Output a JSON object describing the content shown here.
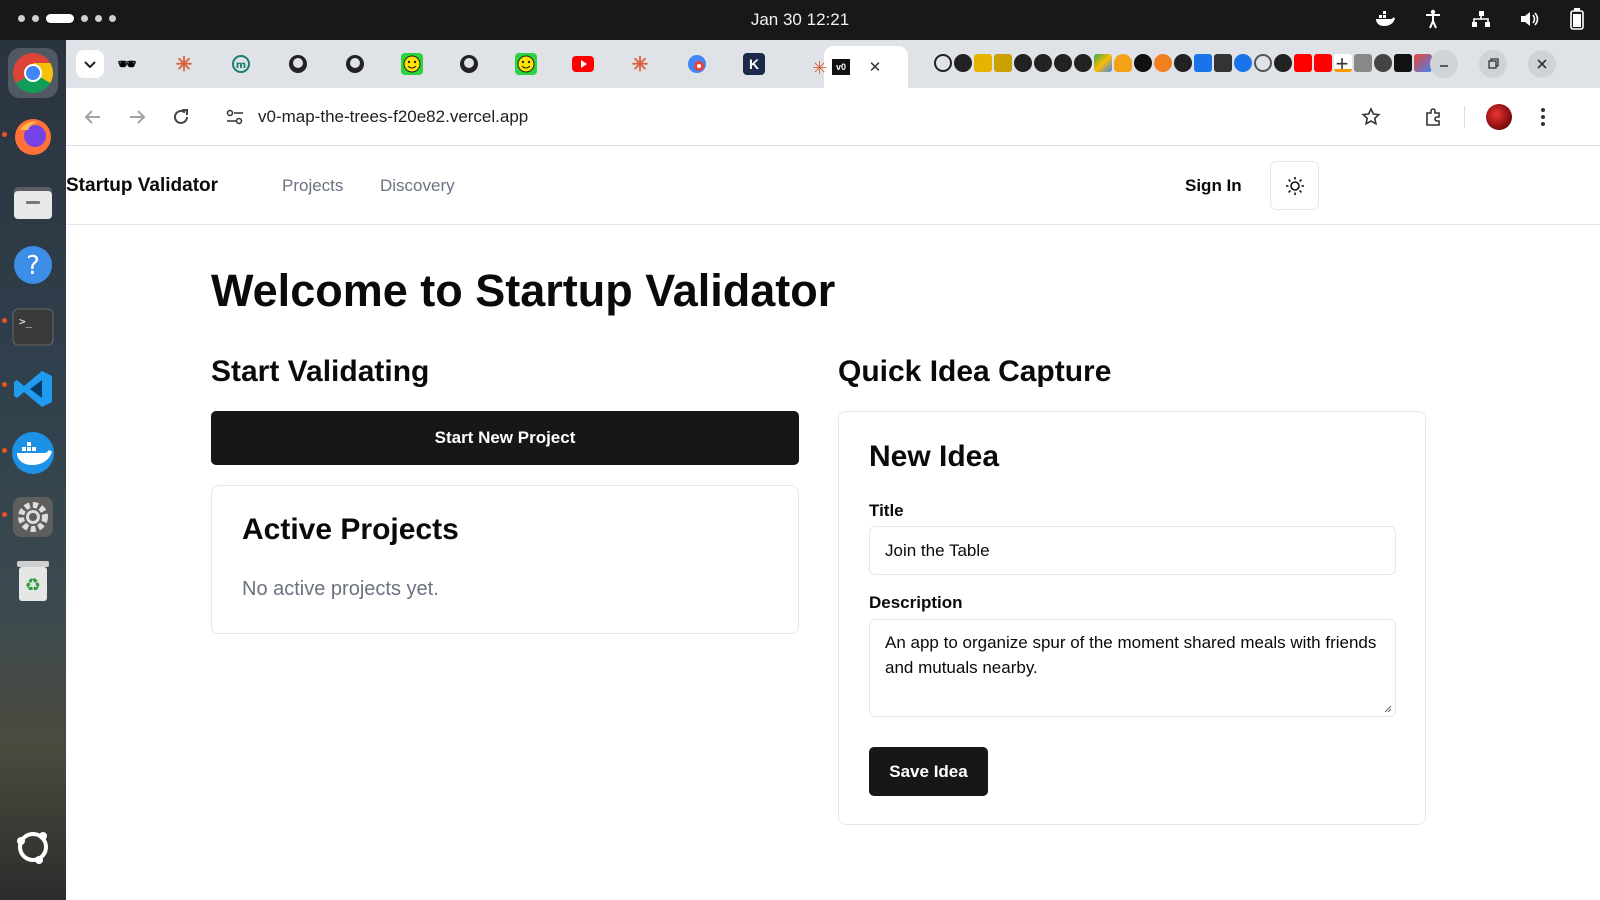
{
  "system": {
    "clock": "Jan 30  12:21"
  },
  "browser": {
    "url": "v0-map-the-trees-f20e82.vercel.app",
    "active_tab_close": "✕",
    "new_tab": "+"
  },
  "site": {
    "brand": "Startup Validator",
    "nav": [
      "Projects",
      "Discovery"
    ],
    "sign_in": "Sign In"
  },
  "main": {
    "heading": "Welcome to Startup Validator",
    "start_section": {
      "title": "Start Validating",
      "button": "Start New Project"
    },
    "active_projects": {
      "title": "Active Projects",
      "empty_text": "No active projects yet."
    },
    "quick_capture": {
      "title": "Quick Idea Capture",
      "card_title": "New Idea",
      "title_label": "Title",
      "title_value": "Join the Table",
      "description_label": "Description",
      "description_value": "An app to organize spur of the moment shared meals with friends and mutuals nearby.",
      "save_button": "Save Idea"
    }
  },
  "colors": {
    "primary": "#171717",
    "muted_text": "#6b7280",
    "border": "#e5e7eb"
  }
}
